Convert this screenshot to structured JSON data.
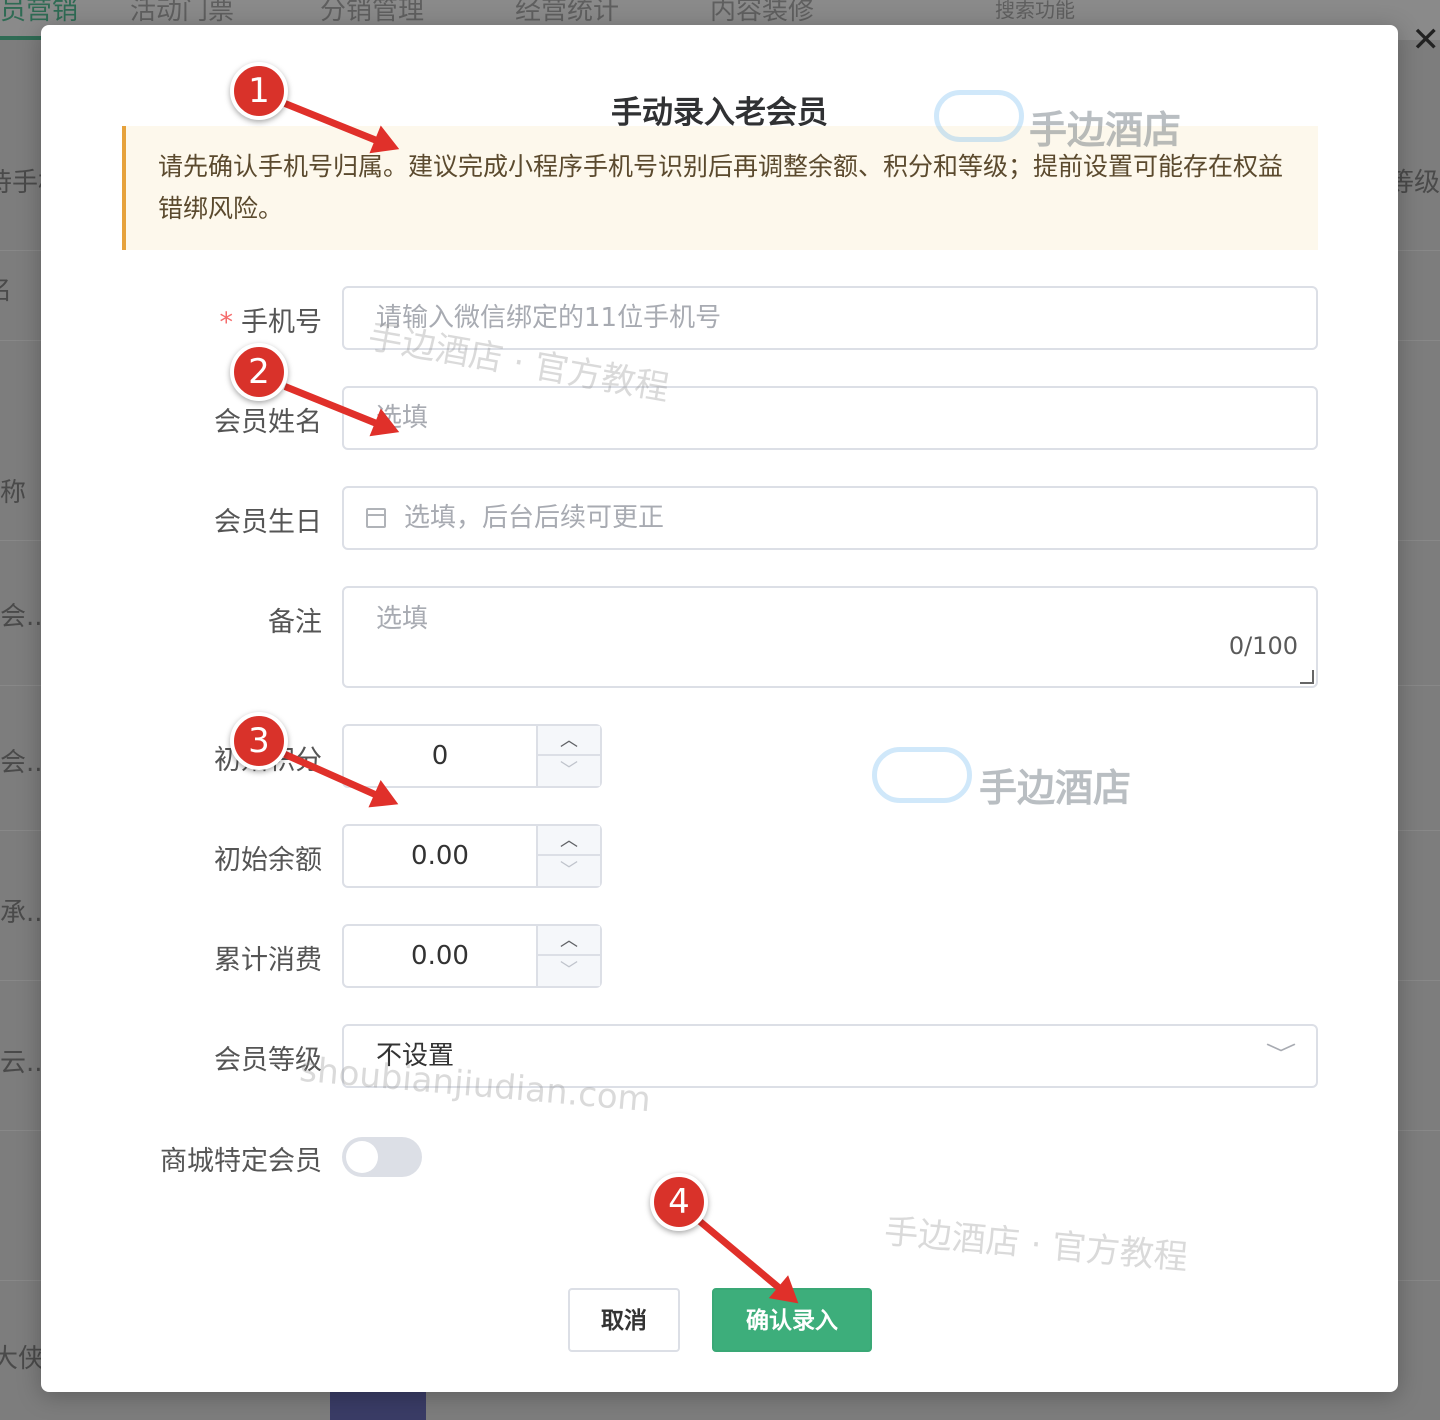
{
  "background": {
    "nav": [
      "员营销",
      "活动门票",
      "分销管理",
      "经营统计",
      "内容装修",
      "搜索功能"
    ],
    "side_texts": [
      "待手机",
      "名",
      "称",
      "会..",
      "会..",
      "承..",
      "云..",
      "大侠"
    ],
    "right_text": "口等级"
  },
  "modal": {
    "title": "手动录入老会员",
    "notice": "请先确认手机号归属。建议完成小程序手机号识别后再调整余额、积分和等级；提前设置可能存在权益错绑风险。",
    "fields": {
      "phone": {
        "label": "手机号",
        "required_mark": "*",
        "placeholder": "请输入微信绑定的11位手机号"
      },
      "name": {
        "label": "会员姓名",
        "placeholder": "选填"
      },
      "birthday": {
        "label": "会员生日",
        "placeholder": "选填，后台后续可更正"
      },
      "remark": {
        "label": "备注",
        "placeholder": "选填",
        "counter": "0/100"
      },
      "points": {
        "label": "初始积分",
        "value": "0"
      },
      "balance": {
        "label": "初始余额",
        "value": "0.00"
      },
      "spent": {
        "label": "累计消费",
        "value": "0.00"
      },
      "level": {
        "label": "会员等级",
        "value": "不设置"
      },
      "mall_member": {
        "label": "商城特定会员",
        "enabled": false
      }
    },
    "buttons": {
      "cancel": "取消",
      "confirm": "确认录入"
    }
  },
  "watermarks": {
    "brand": "手边酒店",
    "tutorial": "手边酒店 · 官方教程",
    "domain": "shoubianjiudian.com"
  },
  "annotations": [
    "1",
    "2",
    "3",
    "4"
  ],
  "colors": {
    "accent": "#3dae7b",
    "warning": "#e6a23c",
    "badge": "#d9322a"
  }
}
